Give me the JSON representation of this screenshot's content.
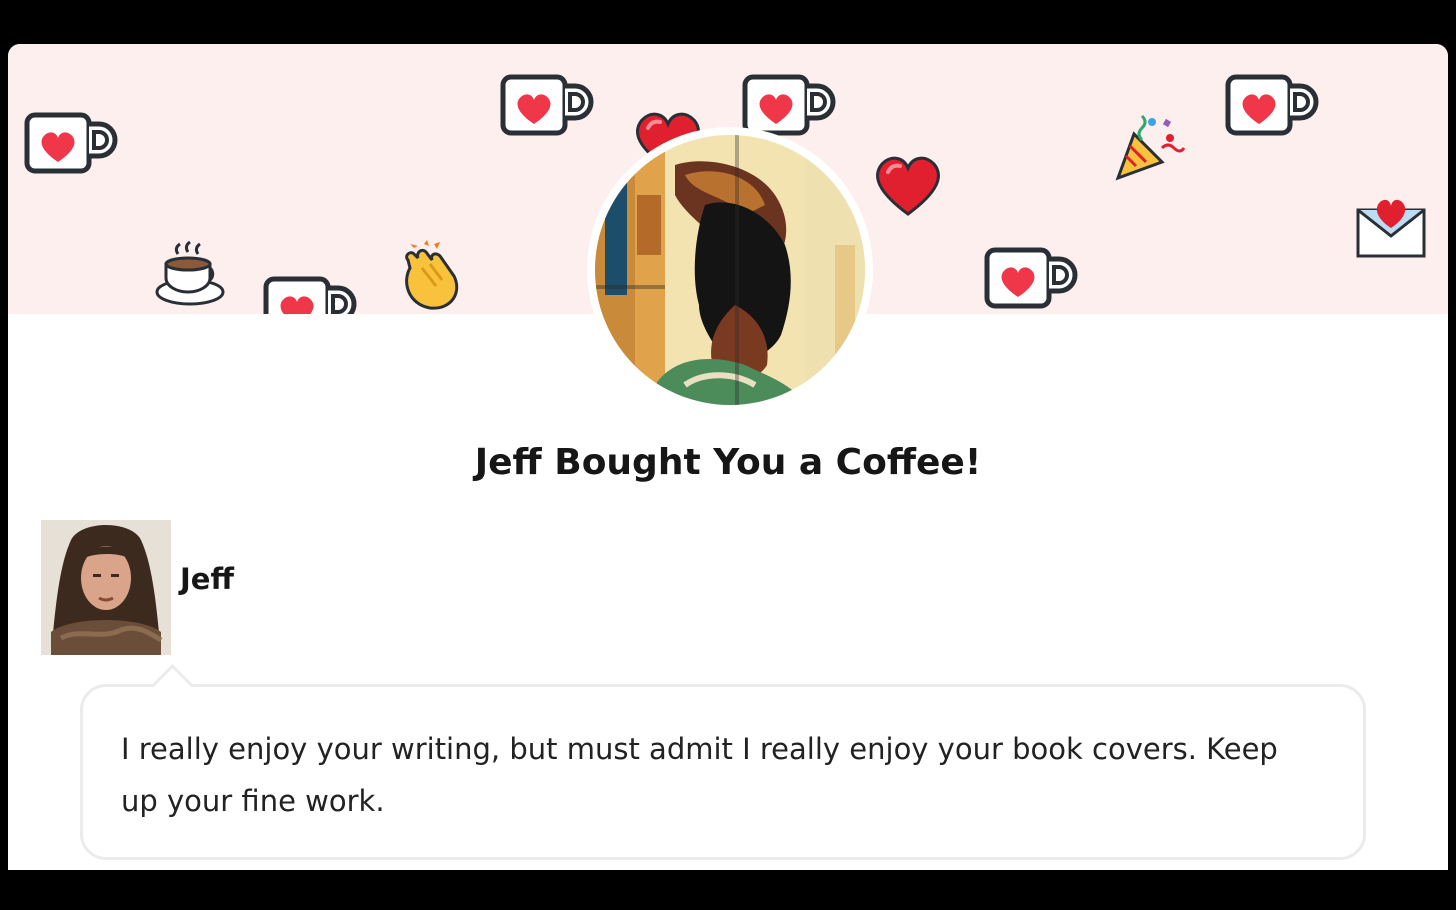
{
  "notification": {
    "title": "Jeff Bought You a Coffee!"
  },
  "supporter": {
    "name": "Jeff",
    "message": "I really enjoy your writing, but must admit I really enjoy your book covers. Keep up your fine work."
  },
  "colors": {
    "banner_bg": "#fcefed",
    "heart": "#f0374a",
    "mug_outline": "#2a2f36",
    "text": "#161616"
  },
  "banner_icons": [
    "ko-fi-mug-icon",
    "coffee-cup-icon",
    "clapping-hands-icon",
    "heart-icon",
    "party-popper-icon",
    "love-letter-icon"
  ]
}
